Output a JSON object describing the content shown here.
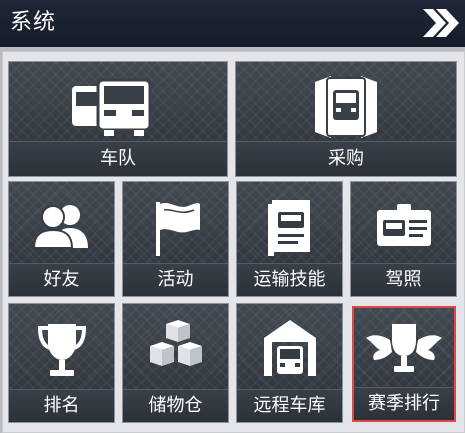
{
  "header": {
    "title": "系统",
    "next_icon": "double-chevron-right-icon"
  },
  "tiles": {
    "fleet": {
      "label": "车队",
      "icon": "trucks-icon"
    },
    "purchase": {
      "label": "采购",
      "icon": "truck-card-icon"
    },
    "friends": {
      "label": "好友",
      "icon": "friends-icon"
    },
    "events": {
      "label": "活动",
      "icon": "flag-icon"
    },
    "skills": {
      "label": "运输技能",
      "icon": "skill-book-icon"
    },
    "license": {
      "label": "驾照",
      "icon": "license-card-icon"
    },
    "ranking": {
      "label": "排名",
      "icon": "trophy-icon"
    },
    "storage": {
      "label": "储物仓",
      "icon": "boxes-icon"
    },
    "garage": {
      "label": "远程车库",
      "icon": "garage-icon"
    },
    "season_rank": {
      "label": "赛季排行",
      "icon": "winged-trophy-icon"
    }
  },
  "colors": {
    "highlight": "#e24646",
    "titlebar": "#1b2230"
  }
}
